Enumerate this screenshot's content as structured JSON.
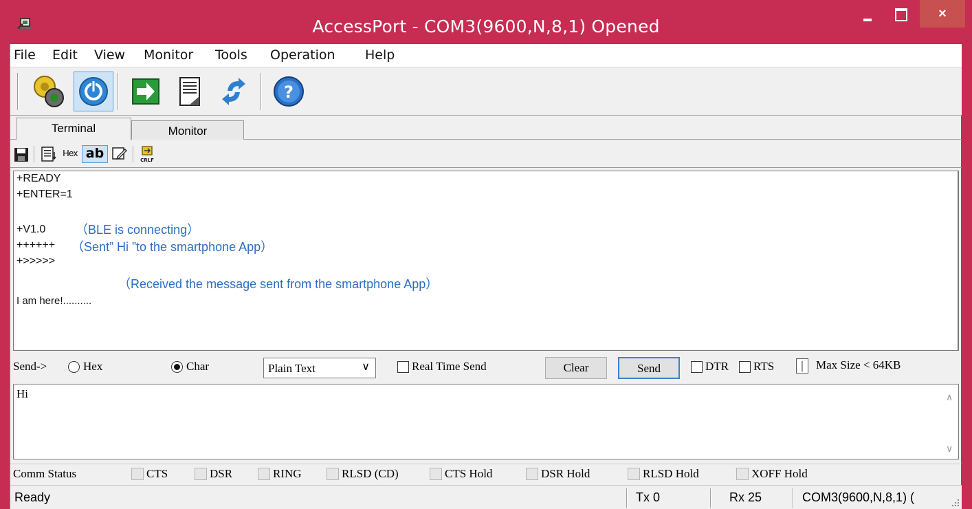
{
  "window": {
    "title": "AccessPort - COM3(9600,N,8,1) Opened",
    "close_glyph": "×"
  },
  "menu": [
    "File",
    "Edit",
    "View",
    "Monitor",
    "Tools",
    "Operation",
    "Help"
  ],
  "toolbar": {
    "icons": [
      "settings-gear-icon",
      "power-icon",
      "arrow-right-icon",
      "document-icon",
      "refresh-arrows-icon",
      "help-icon"
    ],
    "active": "power-icon"
  },
  "tabs": [
    "Terminal",
    "Monitor"
  ],
  "subtoolbar": {
    "hex_label": "Hex",
    "ab_label": "ab",
    "crlf_label": "CRLF"
  },
  "terminal": {
    "lines": [
      "+READY",
      "+ENTER=1",
      "+V1.0",
      "++++++",
      "+>>>>>",
      "I am here!.........."
    ],
    "annotations": [
      "（BLE is connecting）",
      "（Sent” Hi ”to the smartphone App）",
      "（Received the message sent from the smartphone App）"
    ]
  },
  "sendbar": {
    "label": "Send->",
    "radio_hex": "Hex",
    "radio_char": "Char",
    "selected_mode": "Char",
    "format_value": "Plain Text",
    "format_arrow": "∨",
    "realtime_label": "Real Time Send",
    "clear_label": "Clear",
    "send_label": "Send",
    "dtr_label": "DTR",
    "rts_label": "RTS",
    "pipe_label": "|",
    "maxsize_label": "Max Size < 64KB"
  },
  "send_input": {
    "value": "Hi"
  },
  "comm_status": {
    "label": "Comm Status",
    "items": [
      "CTS",
      "DSR",
      "RING",
      "RLSD (CD)",
      "CTS Hold",
      "DSR Hold",
      "RLSD Hold",
      "XOFF Hold"
    ]
  },
  "statusbar": {
    "status": "Ready",
    "tx": "Tx 0",
    "rx": "Rx 25",
    "port": "COM3(9600,N,8,1) ("
  },
  "colors": {
    "frame": "#c72c53",
    "annotation": "#2c6dc3",
    "active_bg": "#cde4f7"
  }
}
